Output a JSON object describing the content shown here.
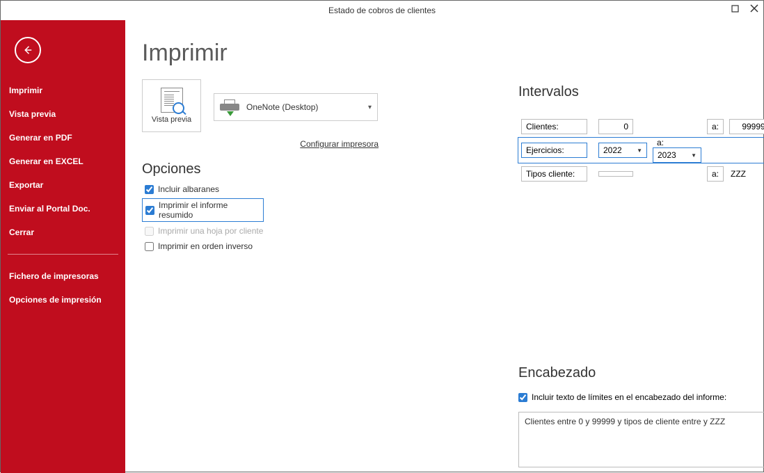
{
  "window": {
    "title": "Estado de cobros de clientes"
  },
  "sidebar": {
    "items": [
      "Imprimir",
      "Vista previa",
      "Generar en PDF",
      "Generar en EXCEL",
      "Exportar",
      "Enviar al Portal Doc.",
      "Cerrar"
    ],
    "items2": [
      "Fichero de impresoras",
      "Opciones de impresión"
    ]
  },
  "page": {
    "heading": "Imprimir",
    "preview_label": "Vista previa",
    "printer_name": "OneNote (Desktop)",
    "configure_link": "Configurar impresora"
  },
  "options": {
    "heading": "Opciones",
    "items": [
      {
        "label": "Incluir albaranes",
        "checked": true,
        "disabled": false,
        "highlight": false
      },
      {
        "label": "Imprimir el informe resumido",
        "checked": true,
        "disabled": false,
        "highlight": true
      },
      {
        "label": "Imprimir una hoja por cliente",
        "checked": false,
        "disabled": true,
        "highlight": false
      },
      {
        "label": "Imprimir en orden inverso",
        "checked": false,
        "disabled": false,
        "highlight": false
      }
    ]
  },
  "intervals": {
    "heading": "Intervalos",
    "a_label": "a:",
    "rows": {
      "clientes": {
        "label": "Clientes:",
        "from": "0",
        "to": "99999"
      },
      "ejercicios": {
        "label": "Ejercicios:",
        "from": "2022",
        "to": "2023"
      },
      "tipos": {
        "label": "Tipos cliente:",
        "from": "",
        "to": "ZZZ"
      }
    }
  },
  "header_section": {
    "heading": "Encabezado",
    "checkbox_label": "Incluir texto de límites en el encabezado del informe:",
    "text": "Clientes entre 0 y 99999 y tipos de cliente entre  y ZZZ"
  }
}
